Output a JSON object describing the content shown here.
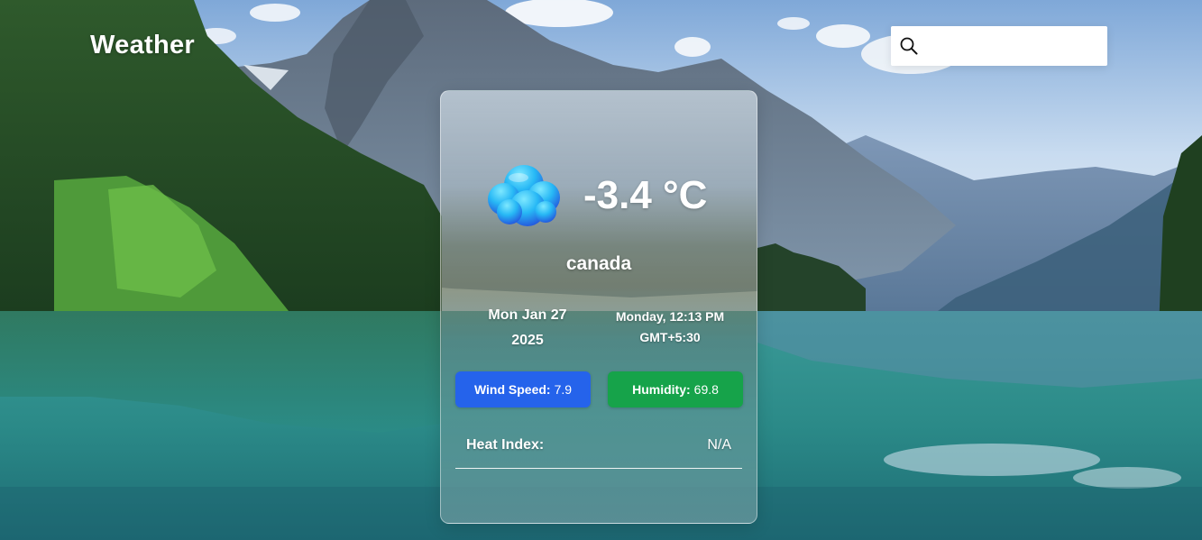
{
  "header": {
    "app_title": "Weather"
  },
  "search": {
    "placeholder": "",
    "value": "",
    "icon": "search-icon"
  },
  "weather": {
    "icon": "cloud-icon",
    "temperature": "-3.4 °C",
    "city": "canada",
    "date_line1": "Mon Jan 27",
    "date_line2": "2025",
    "time_line1": "Monday, 12:13 PM",
    "time_line2": "GMT+5:30"
  },
  "stats": {
    "wind_label": "Wind Speed:",
    "wind_value": "7.9",
    "humidity_label": "Humidity:",
    "humidity_value": "69.8",
    "heat_label": "Heat Index:",
    "heat_value": "N/A"
  },
  "colors": {
    "wind_badge": "#2563eb",
    "humidity_badge": "#16a34a",
    "text": "#ffffff"
  }
}
